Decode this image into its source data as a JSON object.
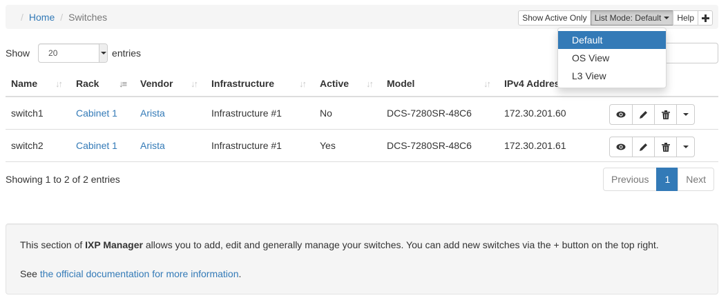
{
  "breadcrumb": {
    "home": "Home",
    "current": "Switches"
  },
  "toolbar": {
    "show_active_only": "Show Active Only",
    "list_mode": "List Mode: Default",
    "help": "Help",
    "add": "+"
  },
  "list_mode_menu": {
    "items": [
      "Default",
      "OS View",
      "L3 View"
    ],
    "selected": "Default"
  },
  "length_control": {
    "before": "Show",
    "value": "20",
    "after": "entries"
  },
  "table": {
    "columns": [
      "Name",
      "Rack",
      "Vendor",
      "Infrastructure",
      "Active",
      "Model",
      "IPv4 Address"
    ],
    "rows": [
      {
        "name": "switch1",
        "rack": "Cabinet 1",
        "vendor": "Arista",
        "infrastructure": "Infrastructure #1",
        "active": "No",
        "model": "DCS-7280SR-48C6",
        "ipv4": "172.30.201.60"
      },
      {
        "name": "switch2",
        "rack": "Cabinet 1",
        "vendor": "Arista",
        "infrastructure": "Infrastructure #1",
        "active": "Yes",
        "model": "DCS-7280SR-48C6",
        "ipv4": "172.30.201.61"
      }
    ]
  },
  "table_info": "Showing 1 to 2 of 2 entries",
  "pagination": {
    "previous": "Previous",
    "current": "1",
    "next": "Next"
  },
  "well": {
    "line1_pre": "This section of ",
    "line1_bold": "IXP Manager",
    "line1_post": " allows you to add, edit and generally manage your switches. You can add new switches via the + button on the top right.",
    "line2_pre": "See ",
    "line2_link": "the official documentation for more information",
    "line2_post": "."
  },
  "colors": {
    "link": "#337ab7",
    "active_page": "#337ab7",
    "well_bg": "#f5f5f5"
  }
}
